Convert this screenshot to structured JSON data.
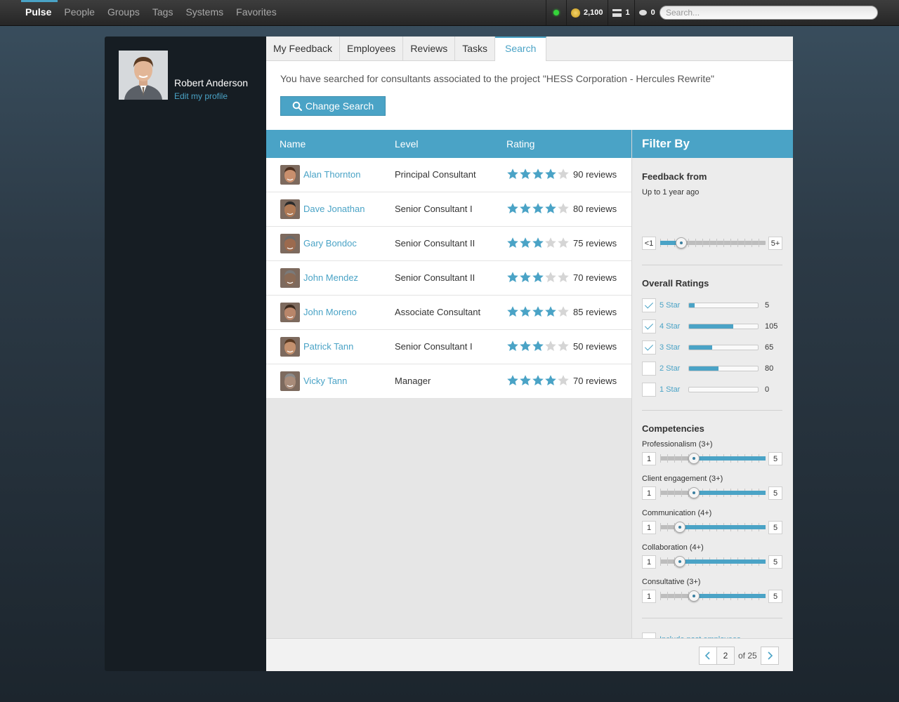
{
  "topnav": {
    "items": [
      "Pulse",
      "People",
      "Groups",
      "Tags",
      "Systems",
      "Favorites"
    ],
    "active": "Pulse"
  },
  "status": {
    "points": "2,100",
    "servers": "1",
    "messages": "0"
  },
  "search": {
    "placeholder": "Search..."
  },
  "profile": {
    "name": "Robert Anderson",
    "edit_label": "Edit my profile"
  },
  "tabs": [
    "My Feedback",
    "Employees",
    "Reviews",
    "Tasks",
    "Search"
  ],
  "active_tab": "Search",
  "search_info": {
    "text": "You have searched for consultants associated to the project \"HESS Corporation - Hercules Rewrite\"",
    "change_button": "Change Search"
  },
  "table": {
    "columns": [
      "Name",
      "Level",
      "Rating"
    ],
    "rows": [
      {
        "name": "Alan Thornton",
        "level": "Principal Consultant",
        "rating": 4,
        "reviews": "90 reviews"
      },
      {
        "name": "Dave Jonathan",
        "level": "Senior Consultant I",
        "rating": 4,
        "reviews": "80 reviews"
      },
      {
        "name": "Gary Bondoc",
        "level": "Senior Consultant II",
        "rating": 3,
        "reviews": "75 reviews"
      },
      {
        "name": "John Mendez",
        "level": "Senior Consultant II",
        "rating": 3,
        "reviews": "70 reviews"
      },
      {
        "name": "John Moreno",
        "level": "Associate Consultant",
        "rating": 4,
        "reviews": "85 reviews"
      },
      {
        "name": "Patrick Tann",
        "level": "Senior Consultant I",
        "rating": 3,
        "reviews": "50 reviews"
      },
      {
        "name": "Vicky Tann",
        "level": "Manager",
        "rating": 4,
        "reviews": "70 reviews"
      }
    ]
  },
  "filter": {
    "title": "Filter By",
    "feedback": {
      "title": "Feedback from",
      "value": "Up to 1 year ago",
      "min_label": "<1",
      "max_label": "5+",
      "position": 0.2
    },
    "ratings": {
      "title": "Overall Ratings",
      "items": [
        {
          "label": "5 Star",
          "count": "5",
          "checked": true,
          "fraction": 0.08
        },
        {
          "label": "4 Star",
          "count": "105",
          "checked": true,
          "fraction": 0.64
        },
        {
          "label": "3 Star",
          "count": "65",
          "checked": true,
          "fraction": 0.34
        },
        {
          "label": "2 Star",
          "count": "80",
          "checked": false,
          "fraction": 0.43
        },
        {
          "label": "1 Star",
          "count": "0",
          "checked": false,
          "fraction": 0.0
        }
      ]
    },
    "competencies": {
      "title": "Competencies",
      "min_label": "1",
      "max_label": "5",
      "items": [
        {
          "label": "Professionalism (3+)",
          "value": 3
        },
        {
          "label": "Client engagement (3+)",
          "value": 3
        },
        {
          "label": "Communication (4+)",
          "value": 4
        },
        {
          "label": "Collaboration (4+)",
          "value": 4
        },
        {
          "label": "Consultative (3+)",
          "value": 3
        }
      ]
    },
    "past_employees_label": "Include past employees"
  },
  "pager": {
    "current": "2",
    "of_label": "of 25"
  },
  "colors": {
    "accent": "#4aa3c6",
    "star_on": "#4aa3c6",
    "star_off": "#d5d5d5"
  }
}
